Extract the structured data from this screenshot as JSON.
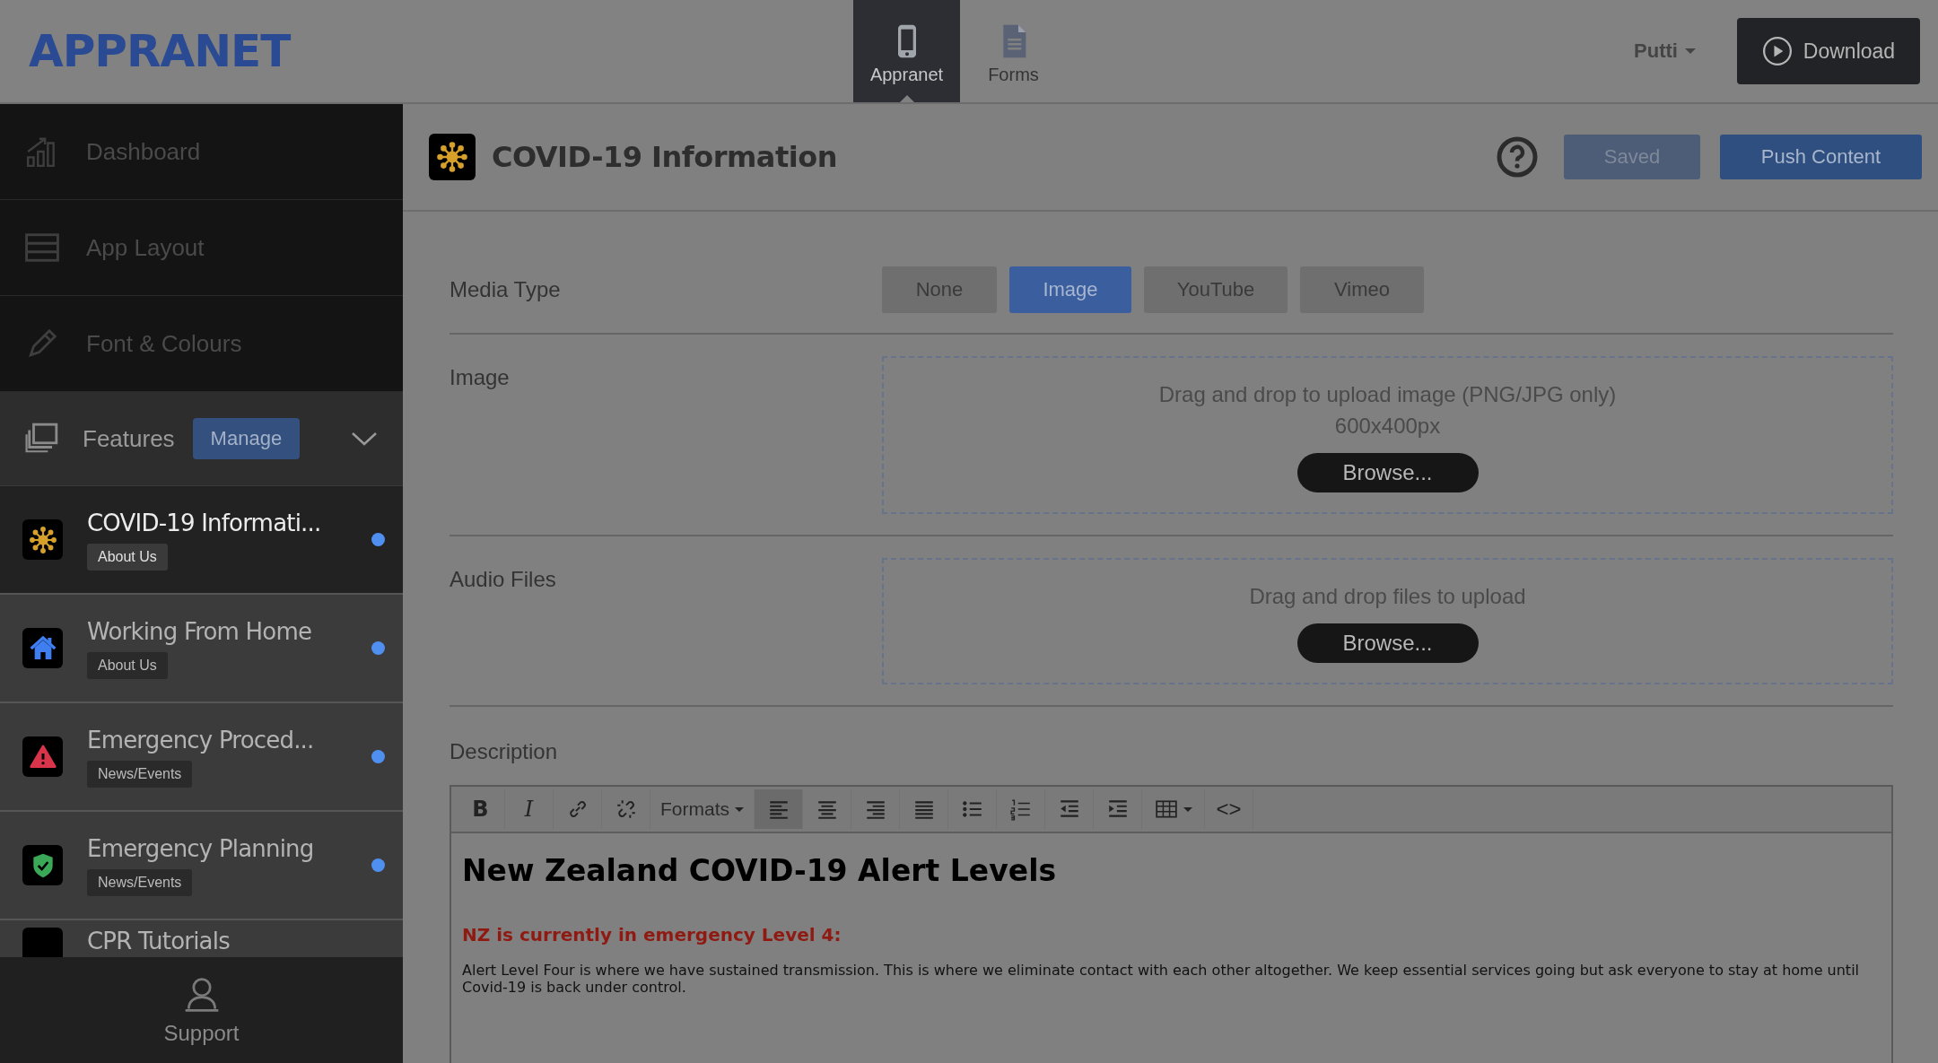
{
  "brand": {
    "logo": "APPRANET"
  },
  "top_tabs": [
    {
      "label": "Appranet",
      "selected": true
    },
    {
      "label": "Forms",
      "selected": false
    }
  ],
  "user_menu": {
    "label": "Putti"
  },
  "download_button": {
    "label": "Download"
  },
  "sidebar": {
    "nav": [
      {
        "label": "Dashboard"
      },
      {
        "label": "App Layout"
      },
      {
        "label": "Font & Colours"
      }
    ],
    "features_header": {
      "label": "Features",
      "button": "Manage",
      "expanded": true
    },
    "features": [
      {
        "title": "COVID-19 Informati...",
        "tag": "About Us",
        "selected": true,
        "unpublished": true
      },
      {
        "title": "Working From Home",
        "tag": "About Us",
        "selected": false,
        "unpublished": true
      },
      {
        "title": "Emergency Proced...",
        "tag": "News/Events",
        "selected": false,
        "unpublished": true
      },
      {
        "title": "Emergency Planning",
        "tag": "News/Events",
        "selected": false,
        "unpublished": true
      },
      {
        "title": "CPR Tutorials",
        "selected": false
      }
    ],
    "support": {
      "label": "Support"
    }
  },
  "page_header": {
    "title": "COVID-19 Information",
    "buttons": [
      {
        "label": "Saved",
        "kind": "secondary",
        "disabled": true
      },
      {
        "label": "Push Content",
        "kind": "primary",
        "disabled": false
      }
    ]
  },
  "media_type": {
    "label": "Media Type",
    "options": [
      {
        "label": "None",
        "selected": false
      },
      {
        "label": "Image",
        "selected": true
      },
      {
        "label": "YouTube",
        "selected": false
      },
      {
        "label": "Vimeo",
        "selected": false
      }
    ]
  },
  "image": {
    "label": "Image",
    "dropzone": [
      "Drag and drop to upload image (PNG/JPG only)",
      "600x400px"
    ],
    "button": "Browse..."
  },
  "audio_files": {
    "label": "Audio Files",
    "dropzone": [
      "Drag and drop files to upload"
    ],
    "button": "Browse..."
  },
  "description": {
    "label": "Description",
    "toolbar": [
      {
        "kind": "bold",
        "label": "B",
        "selected": false
      },
      {
        "kind": "italic",
        "label": "I",
        "selected": false
      },
      {
        "kind": "link",
        "selected": false
      },
      {
        "kind": "unlink",
        "selected": false
      },
      {
        "kind": "formats",
        "label": "Formats",
        "selected": false
      },
      {
        "kind": "align-left",
        "selected": true
      },
      {
        "kind": "align-center",
        "selected": false
      },
      {
        "kind": "align-right",
        "selected": false
      },
      {
        "kind": "justify",
        "selected": false
      },
      {
        "kind": "bullets",
        "selected": false
      },
      {
        "kind": "numbers",
        "selected": false
      },
      {
        "kind": "outdent",
        "selected": false
      },
      {
        "kind": "indent",
        "selected": false
      },
      {
        "kind": "table",
        "selected": false
      },
      {
        "kind": "code",
        "label": "<>",
        "selected": false
      }
    ],
    "content": {
      "heading": "New Zealand COVID-19 Alert Levels",
      "alert": "NZ is currently in emergency Level 4:",
      "paragraph": "Alert Level Four is where we have sustained transmission. This is where we eliminate contact with each other altogether. We keep essential services going but ask everyone to stay at home until Covid-19 is back under control."
    }
  }
}
